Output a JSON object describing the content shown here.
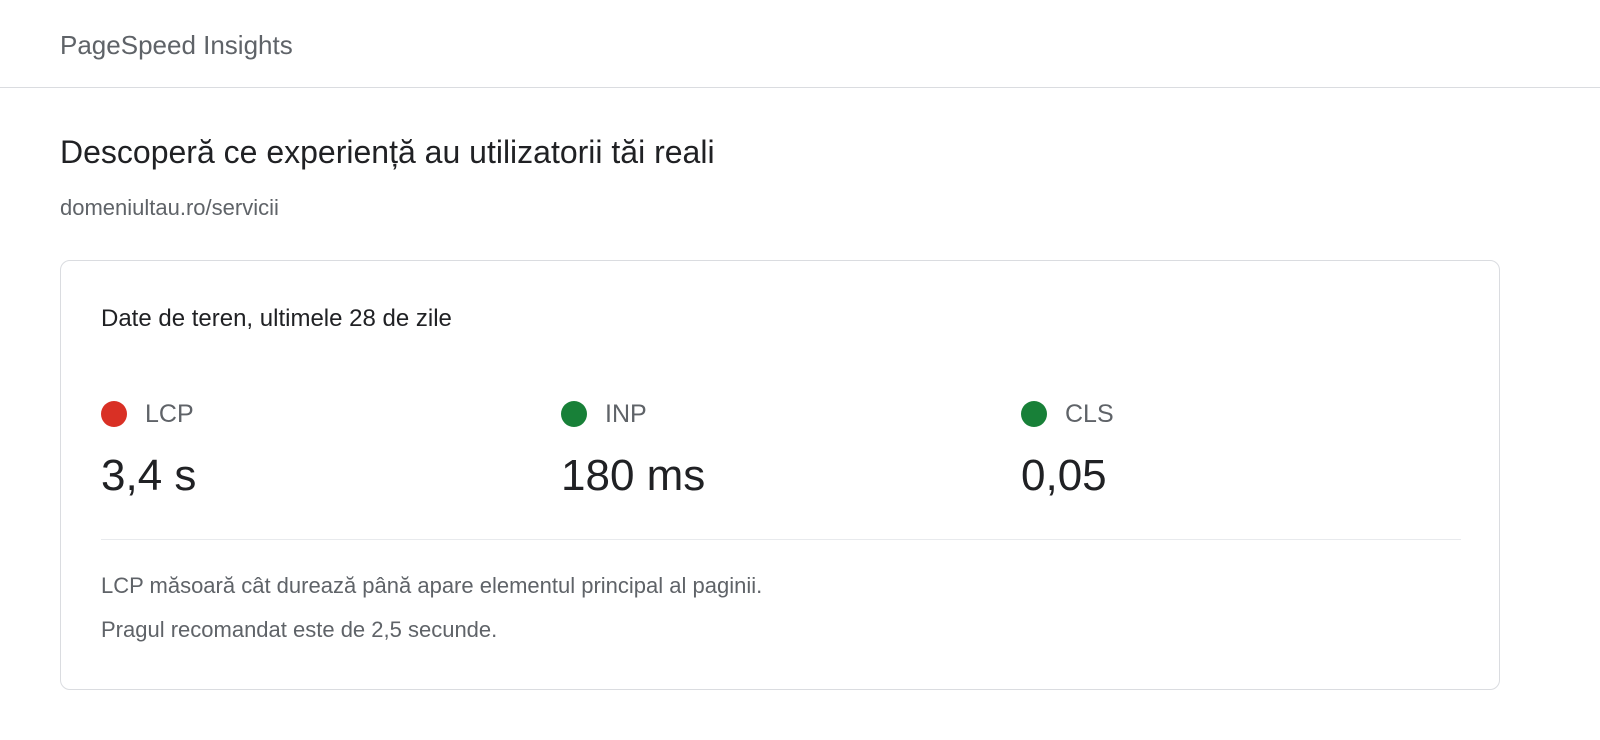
{
  "header": {
    "brand": "PageSpeed Insights"
  },
  "main": {
    "title": "Descoperă ce experiență au utilizatorii tăi reali",
    "url": "domeniultau.ro/servicii"
  },
  "card": {
    "title": "Date de teren, ultimele 28 de zile",
    "metrics": [
      {
        "name": "LCP",
        "value": "3,4 s",
        "status": "poor",
        "color": "#d93025"
      },
      {
        "name": "INP",
        "value": "180 ms",
        "status": "good",
        "color": "#188038"
      },
      {
        "name": "CLS",
        "value": "0,05",
        "status": "good",
        "color": "#188038"
      }
    ],
    "notes": [
      "LCP măsoară cât durează până apare elementul principal al paginii.",
      "Pragul recomandat este de 2,5 secunde."
    ]
  }
}
